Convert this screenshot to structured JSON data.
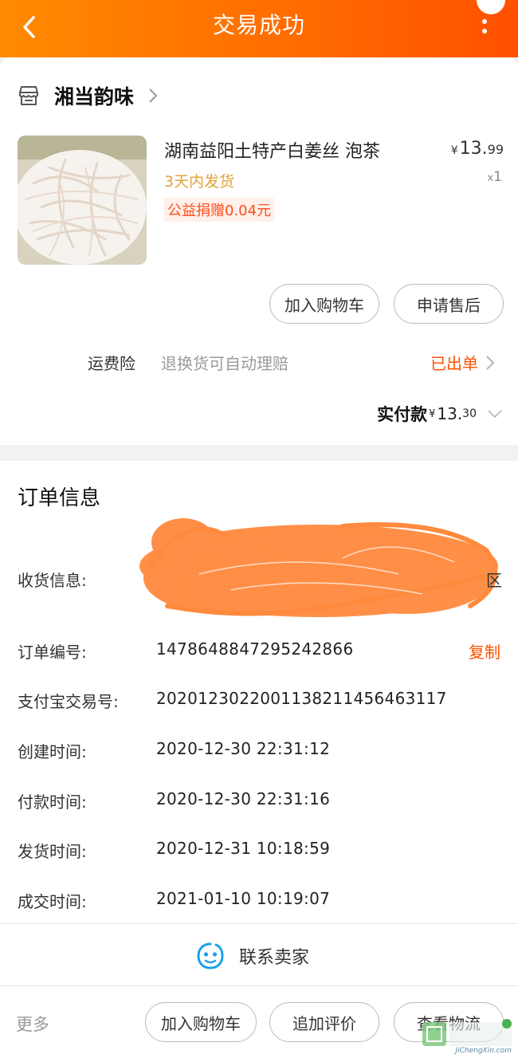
{
  "header": {
    "title": "交易成功"
  },
  "shop": {
    "name": "湘当韵味"
  },
  "product": {
    "name": "湖南益阳土特产白姜丝 泡茶",
    "shipping": "3天内发货",
    "donation": "公益捐赠0.04元",
    "price_currency": "¥",
    "price_int": "13.",
    "price_dec": "99",
    "qty_prefix": "x",
    "qty": "1"
  },
  "item_actions": {
    "add_cart": "加入购物车",
    "after_sale": "申请售后"
  },
  "insurance": {
    "label": "运费险",
    "desc": "退换货可自动理赔",
    "status": "已出单"
  },
  "payment": {
    "label": "实付款",
    "currency": "¥",
    "int": "13.",
    "dec": "30"
  },
  "order_info": {
    "title": "订单信息",
    "address_label": "收货信息:",
    "address_tail": "区",
    "order_no_label": "订单编号:",
    "order_no": "1478648847295242866",
    "copy": "复制",
    "alipay_label": "支付宝交易号:",
    "alipay_no": "2020123022001138211456463117",
    "created_label": "创建时间:",
    "created": "2020-12-30 22:31:12",
    "paid_label": "付款时间:",
    "paid": "2020-12-30 22:31:16",
    "shipped_label": "发货时间:",
    "shipped": "2020-12-31 10:18:59",
    "closed_label": "成交时间:",
    "closed": "2021-01-10 10:19:07"
  },
  "contact": {
    "label": "联系卖家"
  },
  "bottom": {
    "more": "更多",
    "add_cart": "加入购物车",
    "review": "追加评价",
    "logistics": "查看物流"
  },
  "watermark": {
    "text": "JiChengXin.com"
  },
  "colors": {
    "accent": "#ff5000",
    "header_start": "#ff8a00",
    "ship": "#e2a23a"
  }
}
